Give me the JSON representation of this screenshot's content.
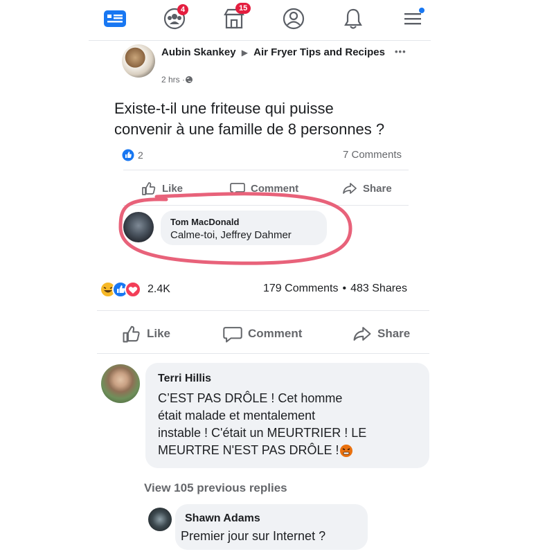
{
  "nav": {
    "friends_badge": "4",
    "marketplace_badge": "15"
  },
  "shared_post": {
    "author": "Aubin Skankey",
    "group": "Air Fryer Tips and Recipes",
    "time": "2 hrs · ",
    "more": "•••",
    "text_line1": "Existe-t-il une friteuse qui puisse",
    "text_line2": "convenir à une famille de 8 personnes ?",
    "likes": "2",
    "comments": "7 Comments",
    "actions": {
      "like": "Like",
      "comment": "Comment",
      "share": "Share"
    },
    "reply": {
      "author": "Tom MacDonald",
      "text": "Calme-toi, Jeffrey Dahmer"
    }
  },
  "post_stats": {
    "reactions": "2.4K",
    "comments": "179 Comments",
    "separator": "•",
    "shares": "483 Shares"
  },
  "actions": {
    "like": "Like",
    "comment": "Comment",
    "share": "Share"
  },
  "comment1": {
    "author": "Terri Hillis",
    "line1": "C’EST PAS DRÔLE ! Cet homme",
    "line2": "était malade et mentalement",
    "line3": "instable ! C'était un MEURTRIER ! LE",
    "line4": "MEURTRE N'EST PAS DRÔLE ! "
  },
  "view_replies": "View 105 previous replies",
  "comment2": {
    "author": "Shawn Adams",
    "text": "Premier jour sur Internet ?"
  },
  "colors": {
    "brand_blue": "#1877f2",
    "highlight_pink": "#e8627a",
    "badge_red": "#e41e3f"
  }
}
